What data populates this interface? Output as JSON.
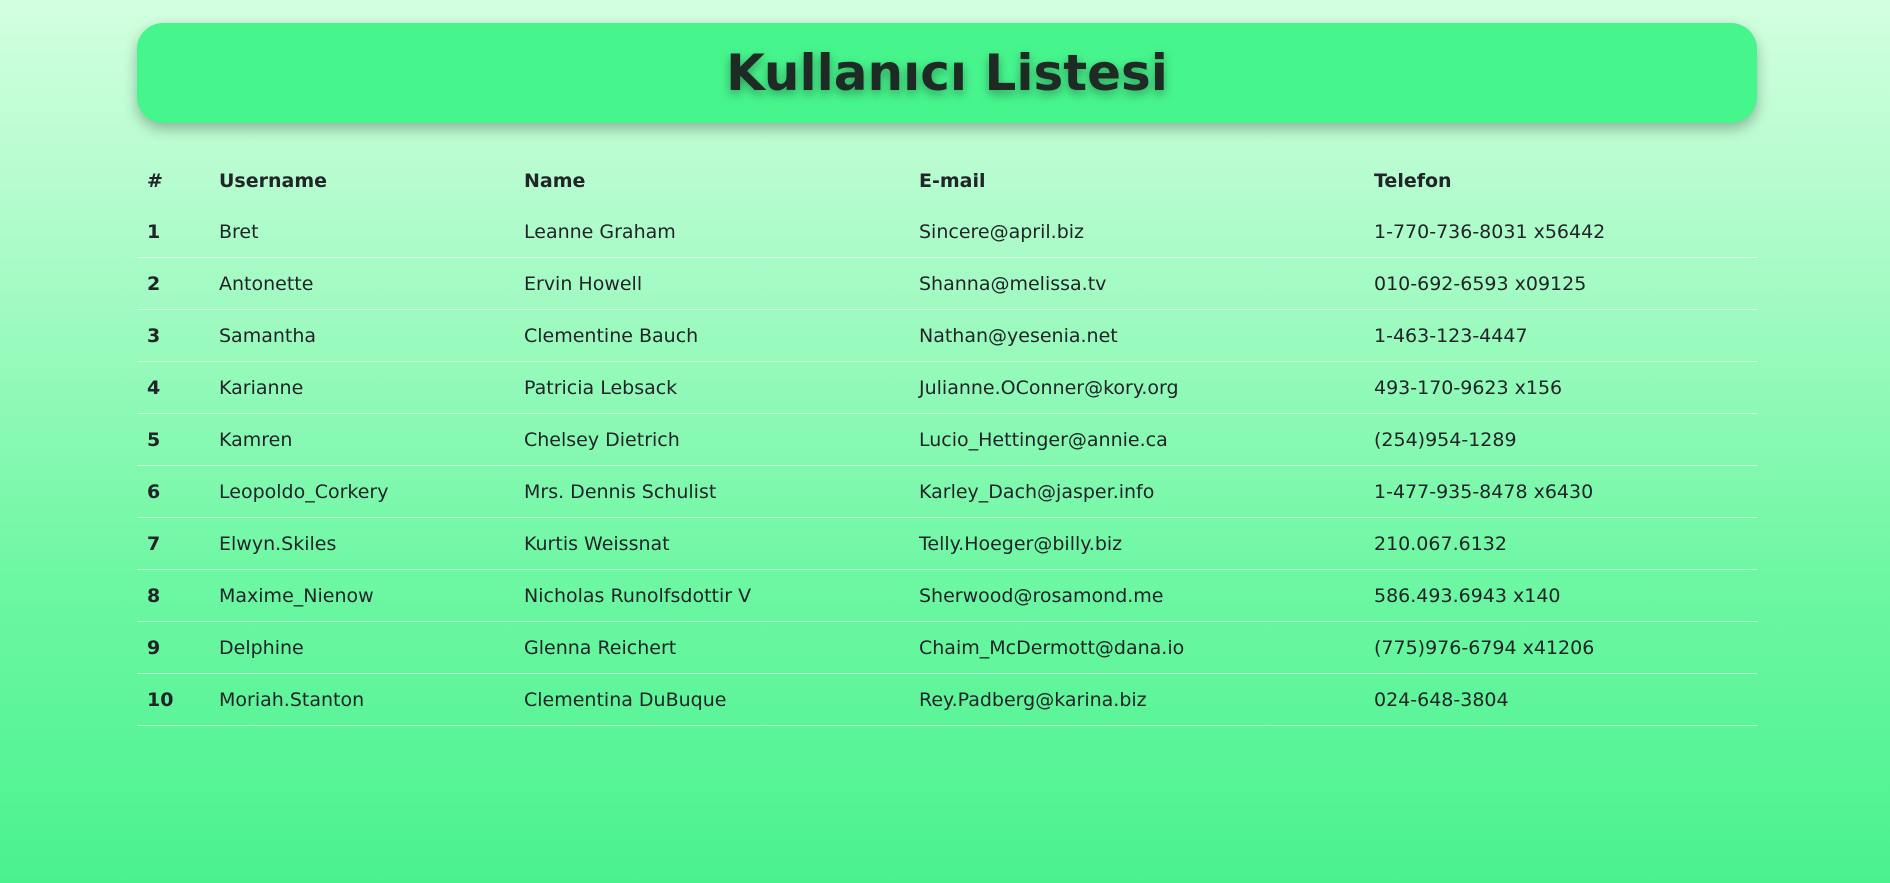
{
  "header": {
    "title": "Kullanıcı Listesi"
  },
  "table": {
    "columns": [
      "#",
      "Username",
      "Name",
      "E-mail",
      "Telefon"
    ],
    "rows": [
      {
        "id": "1",
        "username": "Bret",
        "name": "Leanne Graham",
        "email": "Sincere@april.biz",
        "phone": "1-770-736-8031 x56442"
      },
      {
        "id": "2",
        "username": "Antonette",
        "name": "Ervin Howell",
        "email": "Shanna@melissa.tv",
        "phone": "010-692-6593 x09125"
      },
      {
        "id": "3",
        "username": "Samantha",
        "name": "Clementine Bauch",
        "email": "Nathan@yesenia.net",
        "phone": "1-463-123-4447"
      },
      {
        "id": "4",
        "username": "Karianne",
        "name": "Patricia Lebsack",
        "email": "Julianne.OConner@kory.org",
        "phone": "493-170-9623 x156"
      },
      {
        "id": "5",
        "username": "Kamren",
        "name": "Chelsey Dietrich",
        "email": "Lucio_Hettinger@annie.ca",
        "phone": "(254)954-1289"
      },
      {
        "id": "6",
        "username": "Leopoldo_Corkery",
        "name": "Mrs. Dennis Schulist",
        "email": "Karley_Dach@jasper.info",
        "phone": "1-477-935-8478 x6430"
      },
      {
        "id": "7",
        "username": "Elwyn.Skiles",
        "name": "Kurtis Weissnat",
        "email": "Telly.Hoeger@billy.biz",
        "phone": "210.067.6132"
      },
      {
        "id": "8",
        "username": "Maxime_Nienow",
        "name": "Nicholas Runolfsdottir V",
        "email": "Sherwood@rosamond.me",
        "phone": "586.493.6943 x140"
      },
      {
        "id": "9",
        "username": "Delphine",
        "name": "Glenna Reichert",
        "email": "Chaim_McDermott@dana.io",
        "phone": "(775)976-6794 x41206"
      },
      {
        "id": "10",
        "username": "Moriah.Stanton",
        "name": "Clementina DuBuque",
        "email": "Rey.Padberg@karina.biz",
        "phone": "024-648-3804"
      }
    ]
  }
}
